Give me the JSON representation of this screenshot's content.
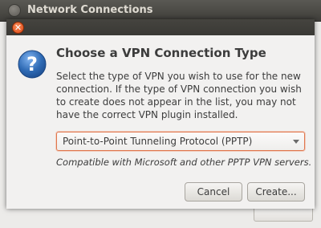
{
  "background_window": {
    "title": "Network Connections"
  },
  "dialog": {
    "heading": "Choose a VPN Connection Type",
    "description": "Select the type of VPN you wish to use for the new connection.  If the type of VPN connection you wish to create does not appear in the list, you may not have the correct VPN plugin installed.",
    "vpn_type_select": {
      "selected": "Point-to-Point Tunneling Protocol (PPTP)"
    },
    "compatibility_note": "Compatible with Microsoft and other PPTP VPN servers.",
    "buttons": {
      "cancel": "Cancel",
      "create": "Create..."
    }
  },
  "icons": {
    "dialog_close": "close-icon",
    "question": "question-icon",
    "dropdown": "chevron-down-icon"
  },
  "colors": {
    "close_button": "#df4a16",
    "focus_border": "#e0764d",
    "question_icon": "#2f6bb5"
  }
}
